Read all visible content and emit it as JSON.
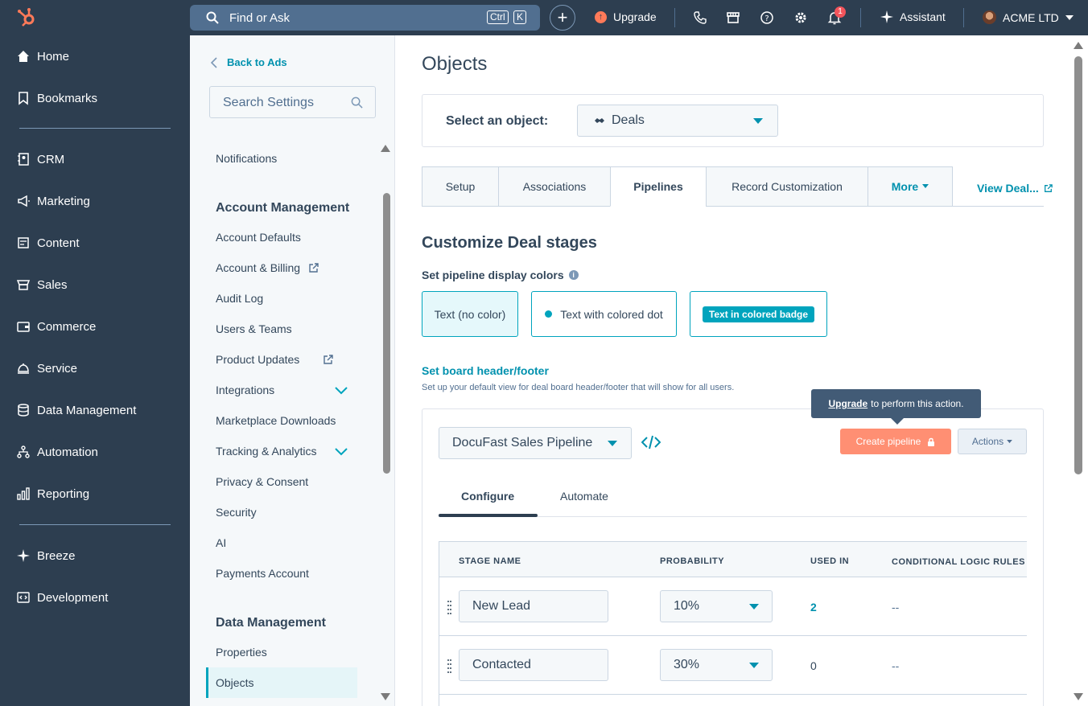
{
  "topbar": {
    "search_placeholder": "Find or Ask",
    "kbd_ctrl": "Ctrl",
    "kbd_k": "K",
    "upgrade_label": "Upgrade",
    "notification_count": "1",
    "assistant_label": "Assistant",
    "account_label": "ACME LTD"
  },
  "leftnav": {
    "items": [
      {
        "label": "Home"
      },
      {
        "label": "Bookmarks"
      },
      {
        "label": "CRM"
      },
      {
        "label": "Marketing"
      },
      {
        "label": "Content"
      },
      {
        "label": "Sales"
      },
      {
        "label": "Commerce"
      },
      {
        "label": "Service"
      },
      {
        "label": "Data Management"
      },
      {
        "label": "Automation"
      },
      {
        "label": "Reporting"
      },
      {
        "label": "Breeze"
      },
      {
        "label": "Development"
      }
    ]
  },
  "settings": {
    "back_label": "Back to Ads",
    "search_placeholder": "Search Settings",
    "notifications": "Notifications",
    "section_account": "Account Management",
    "account_items": [
      "Account Defaults",
      "Account & Billing",
      "Audit Log",
      "Users & Teams",
      "Product Updates",
      "Integrations",
      "Marketplace Downloads",
      "Tracking & Analytics",
      "Privacy & Consent",
      "Security",
      "AI",
      "Payments Account"
    ],
    "section_data": "Data Management",
    "data_items": [
      "Properties",
      "Objects"
    ]
  },
  "main": {
    "page_title": "Objects",
    "select_object_label": "Select an object:",
    "selected_object": "Deals",
    "tabs": [
      "Setup",
      "Associations",
      "Pipelines",
      "Record Customization",
      "More"
    ],
    "active_tab": "Pipelines",
    "view_link": "View Deal...",
    "section_title": "Customize Deal stages",
    "display_colors_label": "Set pipeline display colors",
    "color_options": [
      "Text (no color)",
      "Text with colored dot",
      "Text in colored badge"
    ],
    "board_header_link": "Set board header/footer",
    "board_header_help": "Set up your default view for deal board header/footer that will show for all users.",
    "pipeline_name": "DocuFast Sales Pipeline",
    "create_pipeline_label": "Create pipeline",
    "actions_label": "Actions",
    "tooltip_link": "Upgrade",
    "tooltip_text": "to perform this action.",
    "sub_tabs": [
      "Configure",
      "Automate"
    ],
    "table": {
      "headers": [
        "STAGE NAME",
        "PROBABILITY",
        "USED IN",
        "CONDITIONAL LOGIC RULES"
      ],
      "rows": [
        {
          "stage": "New Lead",
          "probability": "10%",
          "used_in": "2",
          "conditional": "--"
        },
        {
          "stage": "Contacted",
          "probability": "30%",
          "used_in": "0",
          "conditional": "--"
        }
      ]
    }
  },
  "colors": {
    "nav_bg": "#2d3e50",
    "accent_teal": "#00a4bd",
    "link": "#0091ae",
    "orange": "#ff7a59"
  }
}
